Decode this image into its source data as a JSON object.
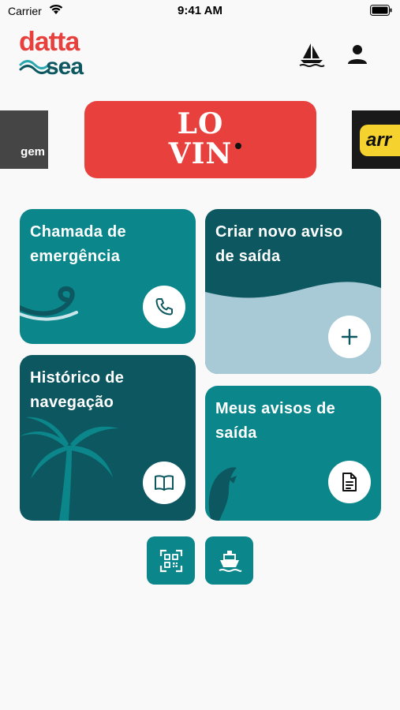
{
  "status_bar": {
    "carrier": "Carrier",
    "time": "9:41 AM"
  },
  "logo": {
    "top": "datta",
    "bottom": "sea"
  },
  "ads": {
    "left_text": "gem",
    "center_text_line1": "LO",
    "center_text_line2": "VIN",
    "right_text": "arr"
  },
  "cards": {
    "emergency": {
      "title_line1": "Chamada de",
      "title_line2": "emergência",
      "icon": "phone-icon"
    },
    "new_notice": {
      "title_line1": "Criar novo aviso",
      "title_line2": "de saída",
      "icon": "plus-icon"
    },
    "history": {
      "title_line1": "Histórico de",
      "title_line2": "navegação",
      "icon": "book-icon"
    },
    "my_notices": {
      "title_line1": "Meus avisos de",
      "title_line2": "saída",
      "icon": "document-icon"
    }
  },
  "bottom_buttons": [
    {
      "icon": "qr-code-icon"
    },
    {
      "icon": "ship-icon"
    }
  ],
  "colors": {
    "brand_red": "#e8413d",
    "teal": "#0b878c",
    "dark_teal": "#0d5860",
    "light_blue": "#a8c9d6"
  }
}
